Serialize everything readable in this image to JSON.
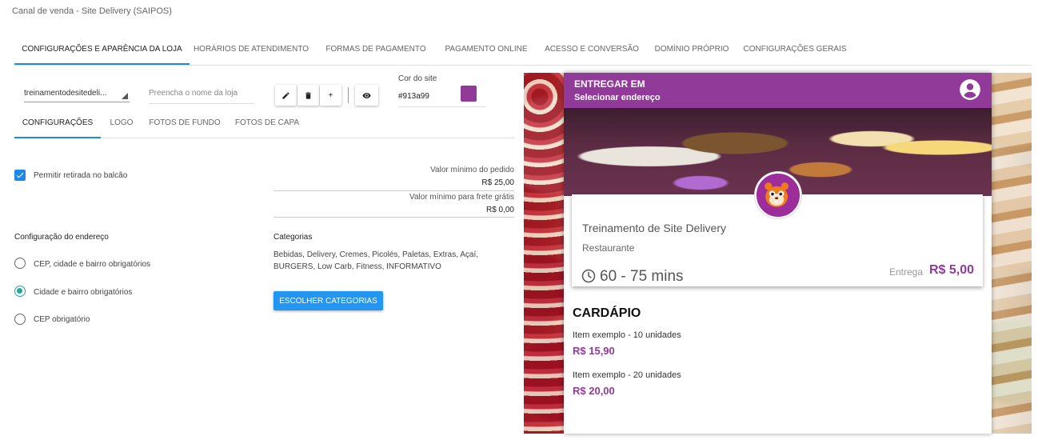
{
  "page": {
    "title": "Canal de venda - Site Delivery (SAIPOS)"
  },
  "top_tabs": [
    {
      "label": "CONFIGURAÇÕES E APARÊNCIA DA LOJA"
    },
    {
      "label": "HORÁRIOS DE ATENDIMENTO"
    },
    {
      "label": "FORMAS DE PAGAMENTO"
    },
    {
      "label": "PAGAMENTO ONLINE"
    },
    {
      "label": "ACESSO E CONVERSÃO"
    },
    {
      "label": "DOMÍNIO PRÓPRIO"
    },
    {
      "label": "CONFIGURAÇÕES GERAIS"
    }
  ],
  "toolbar": {
    "store_select_value": "treinamentodesitedeli...",
    "name_placeholder": "Preencha o nome da loja",
    "edit_icon": "pencil-icon",
    "delete_icon": "trash-icon",
    "add_label": "+",
    "preview_icon": "eye-icon",
    "color_label": "Cor do site",
    "color_value": "#913a99"
  },
  "sub_tabs": [
    {
      "label": "CONFIGURAÇÕES"
    },
    {
      "label": "LOGO"
    },
    {
      "label": "FOTOS DE FUNDO"
    },
    {
      "label": "FOTOS DE CAPA"
    }
  ],
  "settings": {
    "pickup_label": "Permitir retirada no balcão",
    "pickup_checked": true,
    "min_order_label": "Valor mínimo do pedido",
    "min_order_value": "R$ 25,00",
    "min_free_shipping_label": "Valor mínimo para frete grátis",
    "min_free_shipping_value": "R$ 0,00",
    "address_title": "Configuração do endereço",
    "address_options": [
      {
        "label": "CEP, cidade e bairro obrigatórios",
        "checked": false
      },
      {
        "label": "Cidade e bairro obrigatórios",
        "checked": true
      },
      {
        "label": "CEP obrigatório",
        "checked": false
      }
    ],
    "categories_title": "Categorias",
    "categories_text": "Bebidas, Delivery, Cremes, Picolés, Paletas, Extras, Açaí, BURGERS, Low Carb, Fitness, INFORMATIVO",
    "choose_categories_label": "ESCOLHER CATEGORIAS"
  },
  "preview": {
    "header_line1": "ENTREGAR EM",
    "header_line2": "Selecionar endereço",
    "store_name": "Treinamento de Site Delivery",
    "store_type": "Restaurante",
    "delivery_time": "60 - 75 mins",
    "fee_label": "Entrega",
    "fee_value": "R$ 5,00",
    "menu_title": "CARDÁPIO",
    "items": [
      {
        "name": "Item exemplo - 10 unidades",
        "price": "R$ 15,90"
      },
      {
        "name": "Item exemplo - 20 unidades",
        "price": "R$ 20,00"
      }
    ]
  },
  "colors": {
    "accent_blue": "#1e88e5",
    "button_blue": "#2196f3",
    "site_purple": "#913a99",
    "radio_teal": "#26a69a"
  }
}
